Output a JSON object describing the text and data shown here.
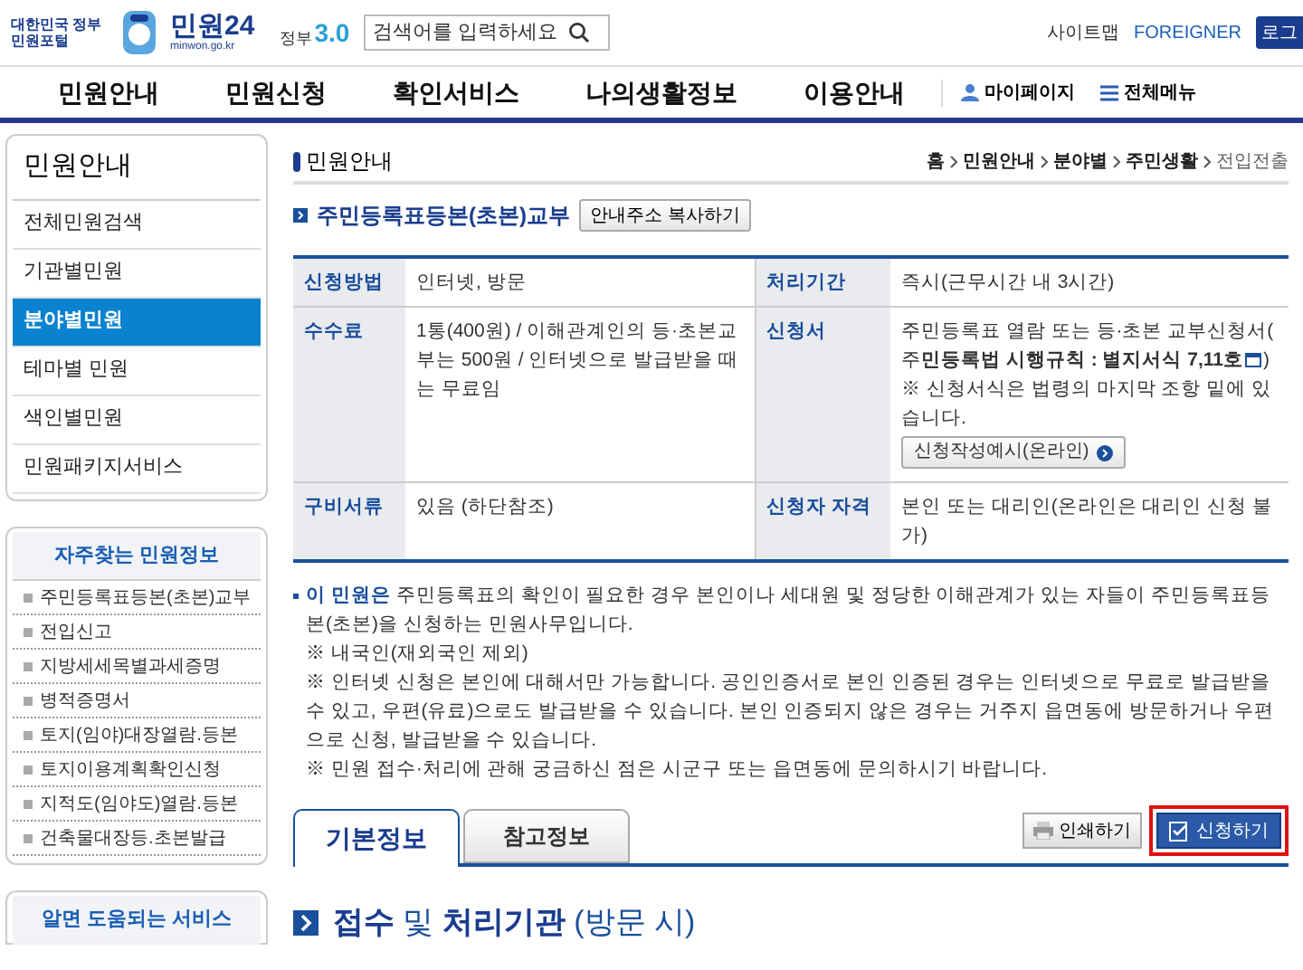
{
  "header": {
    "portal": "대한민국 정부민원포털",
    "logo": "민원24",
    "domain": "minwon.go.kr",
    "gov_label": "정부",
    "gov_version": "3.0",
    "search": {
      "placeholder": "검색어를 입력하세요"
    },
    "top_links": [
      "사이트맵",
      "FOREIGNER"
    ],
    "login": "로그"
  },
  "nav": {
    "items": [
      "민원안내",
      "민원신청",
      "확인서비스",
      "나의생활정보",
      "이용안내"
    ],
    "mypage": "마이페이지",
    "all_menu": "전체메뉴"
  },
  "sidebar": {
    "title": "민원안내",
    "items": [
      {
        "label": "전체민원검색",
        "selected": false
      },
      {
        "label": "기관별민원",
        "selected": false
      },
      {
        "label": "분야별민원",
        "selected": true
      },
      {
        "label": "테마별 민원",
        "selected": false
      },
      {
        "label": "색인별민원",
        "selected": false
      },
      {
        "label": "민원패키지서비스",
        "selected": false
      }
    ],
    "faq": {
      "title": "자주찾는 민원정보",
      "items": [
        "주민등록표등본(초본)교부",
        "전입신고",
        "지방세세목별과세증명",
        "병적증명서",
        "토지(임야)대장열람.등본",
        "토지이용계획확인신청",
        "지적도(임야도)열람.등본",
        "건축물대장등.초본발급"
      ]
    },
    "help": {
      "title": "알면 도움되는 서비스"
    }
  },
  "main": {
    "section": "민원안내",
    "breadcrumb": [
      "홈",
      "민원안내",
      "분야별",
      "주민생활",
      "전입전출"
    ],
    "title": "주민등록표등본(초본)교부",
    "copy_button": "안내주소 복사하기",
    "table": {
      "rows": [
        {
          "label1": "신청방법",
          "value1": "인터넷, 방문",
          "label2": "처리기간",
          "value2": "즉시(근무시간 내 3시간)"
        },
        {
          "label1": "수수료",
          "value1": "1통(400원) / 이해관계인의 등·초본교부는 500원 / 인터넷으로 발급받을 때는 무료임",
          "label2": "신청서",
          "value2": "주민등록표 열람 또는 등·초본 교부신청서( 주**민등록법 시행규칙 : 별지서식 7,11호**",
          "value2_close": ")",
          "value2_note": "※ 신청서식은 법령의 마지막 조항 밑에 있습니다.",
          "value2_button": "신청작성예시(온라인)"
        },
        {
          "label1": "구비서류",
          "value1": "있음 (하단참조)",
          "label2": "신청자 자격",
          "value2": "본인 또는 대리인(온라인은 대리인 신청 불가)"
        }
      ]
    },
    "notes": [
      "**이 민원은** 주민등록표의 확인이 필요한 경우 본인이나 세대원 및 정당한 이해관계가 있는 자들이 주민등록표등본(초본)을 신청하는 민원사무입니다.",
      "※ 내국인(재외국인 제외)",
      "※ 인터넷 신청은 본인에 대해서만 가능합니다. 공인인증서로 본인 인증된 경우는 인터넷으로 무료로 발급받을 수 있고, 우편(유료)으로도 발급받을 수 있습니다. 본인 인증되지 않은 경우는 거주지 읍면동에 방문하거나 우편으로 신청, 발급받을 수 있습니다.",
      "※ 민원 접수·처리에 관해 궁금하신 점은 시군구 또는 읍면동에 문의하시기 바랍니다."
    ],
    "tabs": [
      {
        "label": "기본정보",
        "selected": true
      },
      {
        "label": "참고정보",
        "selected": false
      }
    ],
    "print_button": "인쇄하기",
    "apply_button": {
      "label": "신청하기",
      "highlighted": true
    },
    "subheading": "**접수** 및 **처리기관** (방문 시)"
  }
}
